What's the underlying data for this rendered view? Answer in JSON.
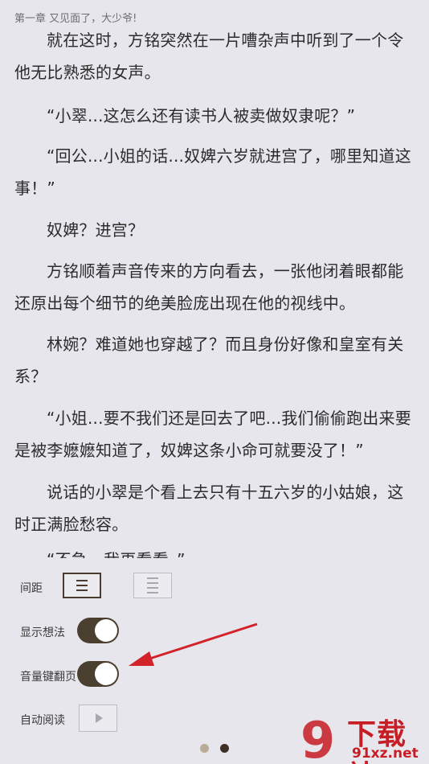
{
  "reader": {
    "chapter_title": "第一章 又见面了，大少爷!",
    "paragraphs": [
      "就在这时，方铭突然在一片嘈杂声中听到了一个令他无比熟悉的女声。",
      "“小翠...这怎么还有读书人被卖做奴隶呢？”",
      "“回公...小姐的话...奴婢六岁就进宫了，哪里知道这事！”",
      "奴婢？进宫？",
      "方铭顺着声音传来的方向看去，一张他闭着眼都能还原出每个细节的绝美脸庞出现在他的视线中。",
      "林婉？难道她也穿越了？而且身份好像和皇室有关系？",
      "“小姐...要不我们还是回去了吧...我们偷偷跑出来要是被李嬷嬷知道了，奴婢这条小命可就要没了！”",
      "说话的小翠是个看上去只有十五六岁的小姑娘，这时正满脸愁容。",
      "“不急，我再看看。”"
    ]
  },
  "settings": {
    "spacing_label": "间距",
    "show_thoughts_label": "显示想法",
    "show_thoughts_on": true,
    "volume_key_label": "音量键翻页",
    "volume_key_on": true,
    "auto_read_label": "自动阅读"
  },
  "pager": {
    "current_page": 2,
    "total_pages": 2
  },
  "watermark": {
    "brand": "下载站",
    "url": "91xz.net",
    "logo_text": "9"
  },
  "colors": {
    "background": "#e7e6ec",
    "toggle_on": "#4b3f30",
    "dot_active": "#3d3127",
    "dot_inactive": "#b9ab95",
    "arrow": "#d3232a",
    "watermark": "#c71d24"
  }
}
